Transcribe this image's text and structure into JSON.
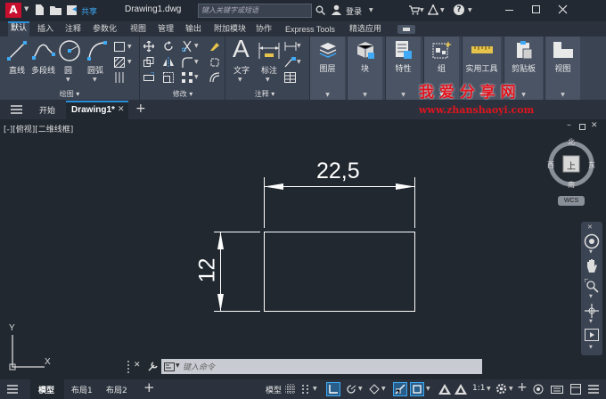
{
  "title": {
    "app_letter": "A",
    "share": "共享",
    "filename": "Drawing1.dwg",
    "search_placeholder": "键入关键字或短语",
    "login": "登录",
    "help": "?"
  },
  "menu_tabs": [
    "默认",
    "插入",
    "注释",
    "参数化",
    "视图",
    "管理",
    "输出",
    "附加模块",
    "协作",
    "Express Tools",
    "精选应用"
  ],
  "ribbon": {
    "draw": {
      "line": "直线",
      "polyline": "多段线",
      "circle": "圆",
      "arc": "圆弧",
      "panel": "绘图"
    },
    "modify": {
      "panel": "修改"
    },
    "annotation": {
      "text": "文字",
      "dim": "标注",
      "panel": "注释"
    },
    "layers": "图层",
    "block": "块",
    "properties": "特性",
    "group": "组",
    "utilities": "实用工具",
    "clipboard": "剪贴板",
    "view": "视图"
  },
  "watermark": {
    "title": "我 爱 分 享 网",
    "url": "www.zhanshaoyi.com"
  },
  "doc_tabs": {
    "start": "开始",
    "drawing": "Drawing1*"
  },
  "viewport": {
    "label": "[-][俯视][二维线框]"
  },
  "viewcube": {
    "north": "北",
    "south": "南",
    "east": "东",
    "west": "西",
    "top": "上",
    "wcs": "WCS"
  },
  "dimensions": {
    "horizontal": "22,5",
    "vertical": "12"
  },
  "ucs": {
    "x": "X",
    "y": "Y"
  },
  "command": {
    "placeholder": "键入命令"
  },
  "layout_tabs": {
    "model": "模型",
    "layout1": "布局1",
    "layout2": "布局2"
  },
  "status": {
    "model": "模型",
    "scale": "1:1"
  },
  "colors": {
    "accent": "#2a8fd8",
    "canvas": "#212830",
    "ribbon": "#3b4453",
    "app_red": "#c8102e",
    "watermark_red": "#e0141e"
  }
}
